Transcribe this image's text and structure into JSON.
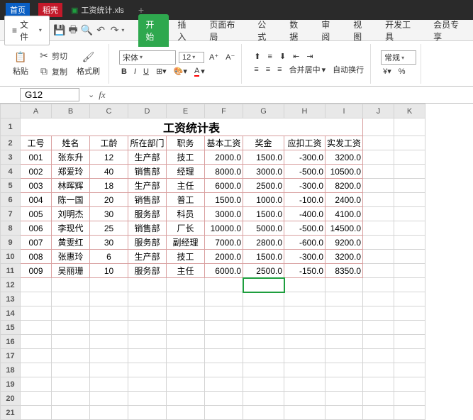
{
  "titlebar": {
    "tab_home": "首页",
    "tab_shell": "稻壳",
    "filename": "工资统计.xls",
    "excel_icon": "excel-icon"
  },
  "menubar": {
    "file": "文件",
    "qat": {
      "save": "save",
      "print": "print",
      "preview": "preview",
      "undo": "undo",
      "redo": "redo"
    },
    "tabs": [
      "开始",
      "插入",
      "页面布局",
      "公式",
      "数据",
      "审阅",
      "视图",
      "开发工具",
      "会员专享"
    ],
    "active_tab": 0
  },
  "ribbon": {
    "paste": "粘贴",
    "cut": "剪切",
    "copy": "复制",
    "format_painter": "格式刷",
    "font_name": "宋体",
    "font_size": "12",
    "merge_center": "合并居中",
    "auto_wrap": "自动换行",
    "number_format": "常规"
  },
  "namebox": {
    "ref": "G12",
    "fx": "fx"
  },
  "sheet": {
    "cols": [
      "A",
      "B",
      "C",
      "D",
      "E",
      "F",
      "G",
      "H",
      "I",
      "J",
      "K"
    ],
    "rows_visible": 21,
    "title": "工资统计表",
    "headers": [
      "工号",
      "姓名",
      "工龄",
      "所在部门",
      "职务",
      "基本工资",
      "奖金",
      "应扣工资",
      "实发工资"
    ],
    "data": [
      [
        "001",
        "张东升",
        "12",
        "生产部",
        "技工",
        "2000.0",
        "1500.0",
        "-300.0",
        "3200.0"
      ],
      [
        "002",
        "郑爱玲",
        "40",
        "销售部",
        "经理",
        "8000.0",
        "3000.0",
        "-500.0",
        "10500.0"
      ],
      [
        "003",
        "林晖辉",
        "18",
        "生产部",
        "主任",
        "6000.0",
        "2500.0",
        "-300.0",
        "8200.0"
      ],
      [
        "004",
        "陈一国",
        "20",
        "销售部",
        "普工",
        "1500.0",
        "1000.0",
        "-100.0",
        "2400.0"
      ],
      [
        "005",
        "刘明杰",
        "30",
        "服务部",
        "科员",
        "3000.0",
        "1500.0",
        "-400.0",
        "4100.0"
      ],
      [
        "006",
        "李现代",
        "25",
        "销售部",
        "厂长",
        "10000.0",
        "5000.0",
        "-500.0",
        "14500.0"
      ],
      [
        "007",
        "黄雯红",
        "30",
        "服务部",
        "副经理",
        "7000.0",
        "2800.0",
        "-600.0",
        "9200.0"
      ],
      [
        "008",
        "张惠玲",
        "6",
        "生产部",
        "技工",
        "2000.0",
        "1500.0",
        "-300.0",
        "3200.0"
      ],
      [
        "009",
        "吴丽珊",
        "10",
        "服务部",
        "主任",
        "6000.0",
        "2500.0",
        "-150.0",
        "8350.0"
      ]
    ],
    "active_cell": "G12"
  }
}
